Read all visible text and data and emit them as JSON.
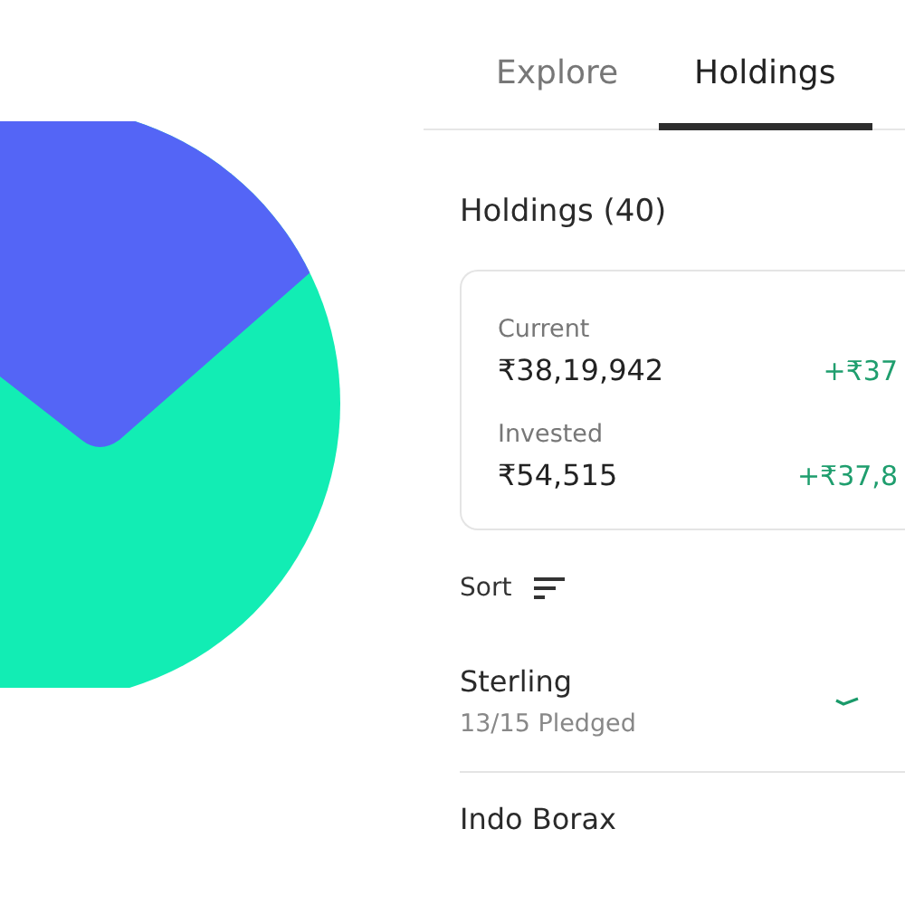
{
  "tabs": [
    {
      "label": "Explore",
      "selected": false
    },
    {
      "label": "Holdings",
      "selected": true
    }
  ],
  "section_title": "Holdings (40)",
  "summary": [
    {
      "label": "Current",
      "value": "₹38,19,942",
      "change": "+₹37"
    },
    {
      "label": "Invested",
      "value": "₹54,515",
      "change": "+₹37,8"
    }
  ],
  "sort": {
    "label": "Sort"
  },
  "holdings": [
    {
      "name": "Sterling",
      "subtitle": "13/15 Pledged"
    },
    {
      "name": "Indo Borax"
    }
  ]
}
